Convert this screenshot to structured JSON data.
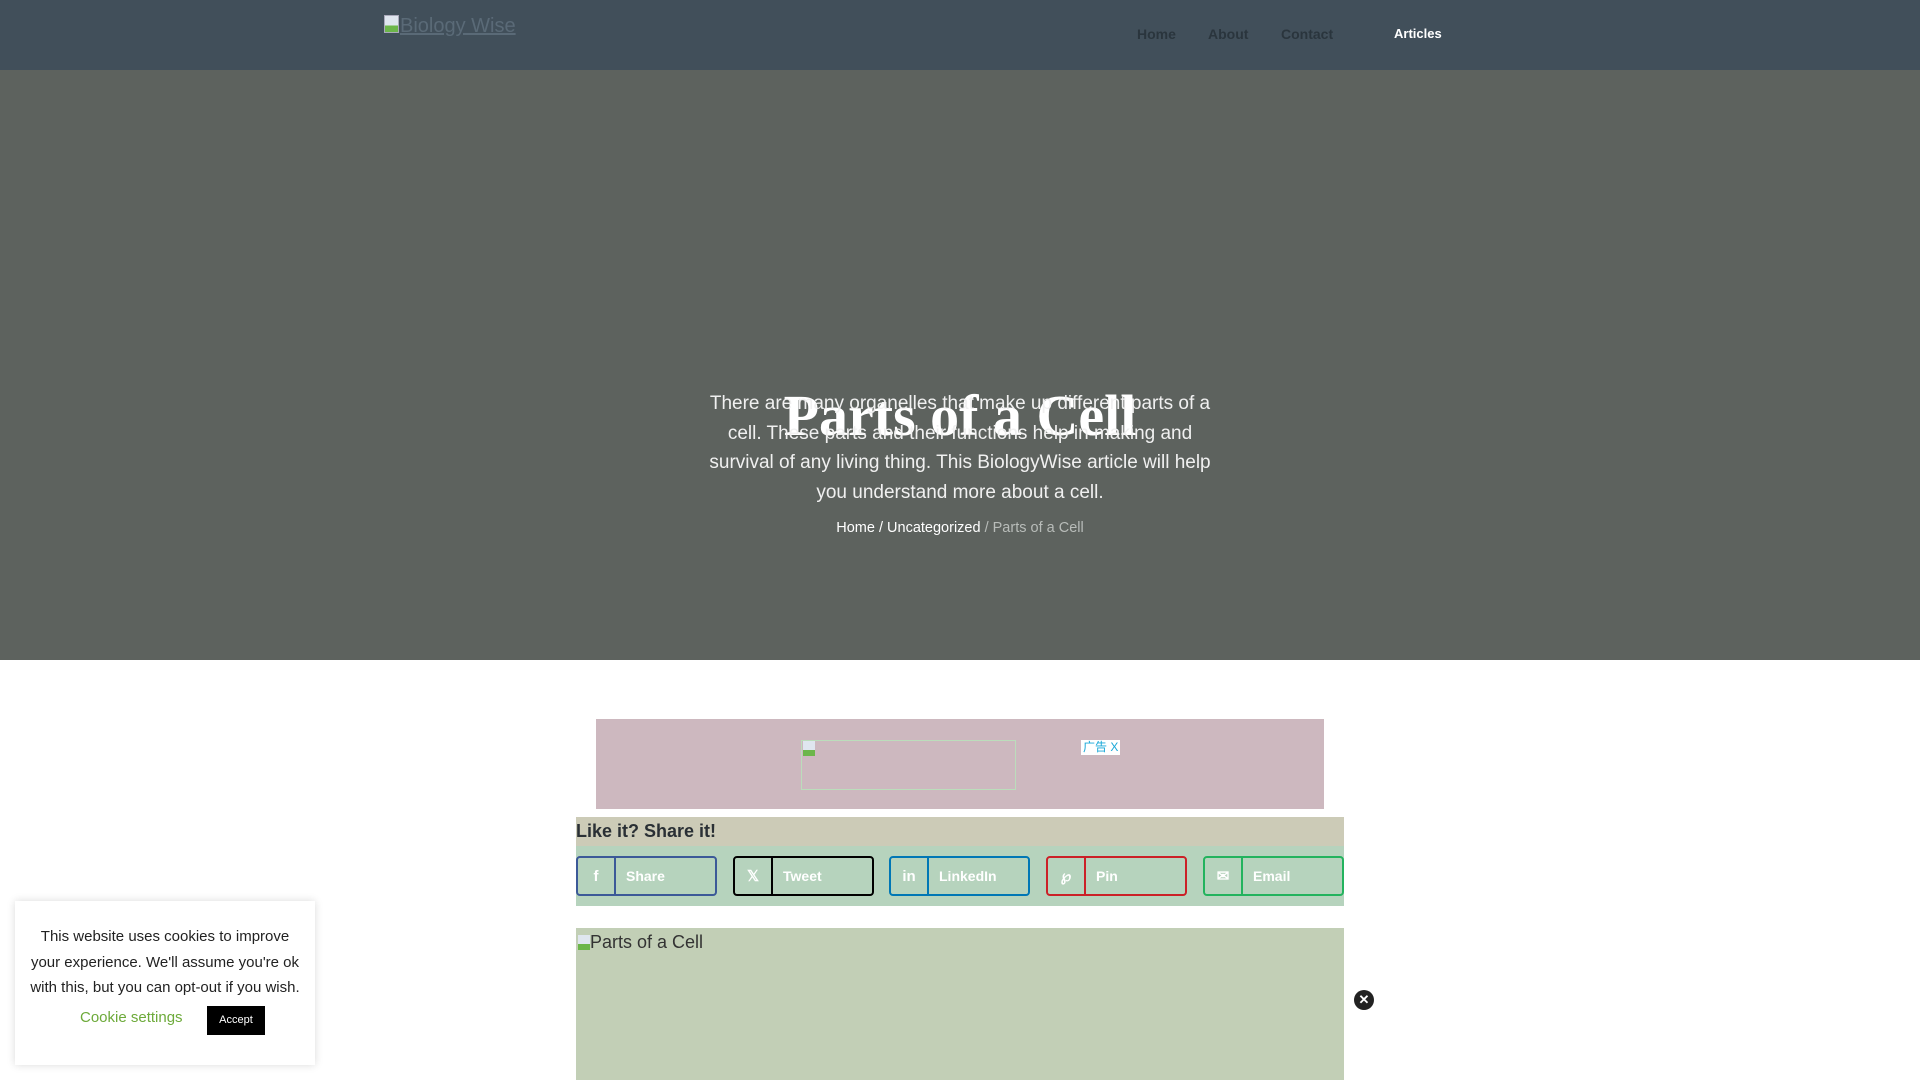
{
  "header": {
    "logo_alt": "Biology Wise",
    "nav": [
      "Home",
      "About",
      "Contact",
      "Articles"
    ]
  },
  "hero": {
    "title": "Parts of a Cell",
    "description": "There are many organelles that make up different parts of a cell. These parts and their functions help in making and survival of any living thing. This BiologyWise article will help you understand more about a cell.",
    "breadcrumb": {
      "home": "Home",
      "sep": "/",
      "category": "Uncategorized",
      "current": "Parts of a Cell"
    }
  },
  "ad": {
    "tag": "广告",
    "close": "X"
  },
  "share": {
    "heading": "Like it? Share it!",
    "buttons": [
      {
        "label": "Share",
        "icon": "f",
        "color": "#3b5998"
      },
      {
        "label": "Tweet",
        "icon": "𝕏",
        "color": "#000000"
      },
      {
        "label": "LinkedIn",
        "icon": "in",
        "color": "#0077b5"
      },
      {
        "label": "Pin",
        "icon": "℘",
        "color": "#cb2027"
      },
      {
        "label": "Email",
        "icon": "✉",
        "color": "#23b35e"
      }
    ]
  },
  "image": {
    "alt": "Parts of a Cell"
  },
  "close_icon": "✕",
  "cookie": {
    "text": "This website uses cookies to improve your experience. We'll assume you're ok with this, but you can opt-out if you wish.",
    "settings": "Cookie settings",
    "accept": "Accept"
  }
}
